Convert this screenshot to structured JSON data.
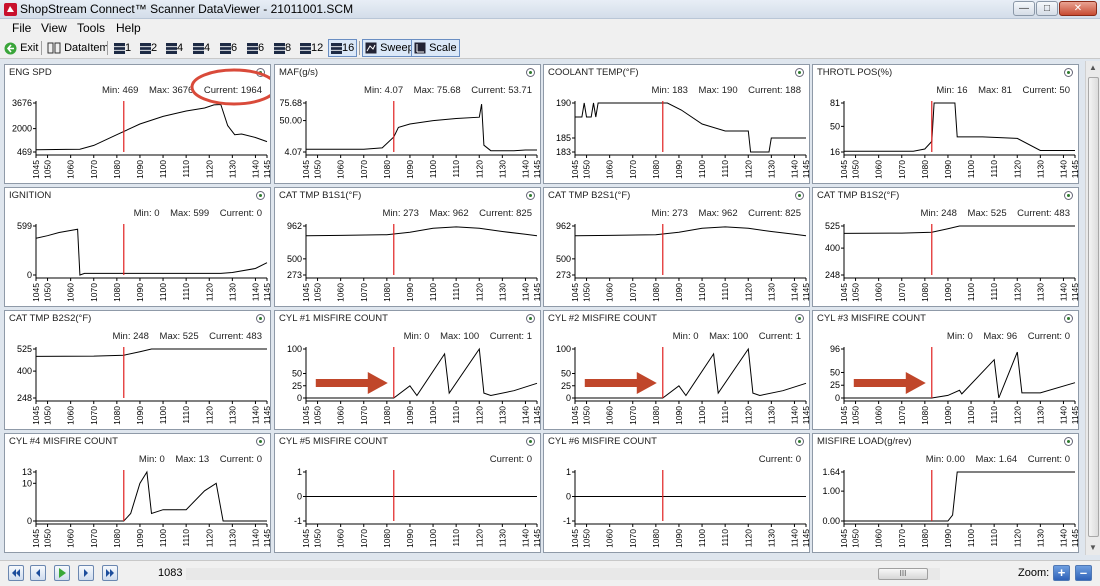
{
  "window": {
    "title": "ShopStream Connect™ Scanner DataViewer - 21011001.SCM"
  },
  "menu": [
    "File",
    "View",
    "Tools",
    "Help"
  ],
  "toolbar": {
    "exit": "Exit",
    "dataitem": "DataItem",
    "layouts": [
      "1",
      "2",
      "4",
      "4",
      "6",
      "6",
      "8",
      "12",
      "16"
    ],
    "sweep": "Sweep",
    "scale": "Scale"
  },
  "x_ticks": [
    "1045",
    "1050",
    "1060",
    "1070",
    "1080",
    "1090",
    "1100",
    "1110",
    "1120",
    "1130",
    "1140",
    "1145"
  ],
  "x_range": [
    1045,
    1145
  ],
  "cursor_x": 1083,
  "colors": {
    "cursor": "#e02020",
    "trace": "#000000",
    "arrow": "#c0462a",
    "annotation_circle": "#d94a3a"
  },
  "panels": [
    {
      "title": "ENG SPD",
      "min": "469",
      "max": "3676",
      "current": "1964",
      "ymin": 469,
      "ymax": 3676,
      "yticks": [
        {
          "v": 3676,
          "t": "3676"
        },
        {
          "v": 2000,
          "t": "2000"
        },
        {
          "v": 469,
          "t": "469"
        }
      ],
      "points": [
        [
          1045,
          620
        ],
        [
          1058,
          640
        ],
        [
          1064,
          650
        ],
        [
          1070,
          900
        ],
        [
          1080,
          1600
        ],
        [
          1090,
          2300
        ],
        [
          1100,
          2800
        ],
        [
          1110,
          3150
        ],
        [
          1118,
          3350
        ],
        [
          1122,
          3550
        ],
        [
          1125,
          3580
        ],
        [
          1128,
          2200
        ],
        [
          1131,
          1600
        ],
        [
          1134,
          1650
        ],
        [
          1140,
          1420
        ],
        [
          1145,
          1150
        ]
      ],
      "annotation": "circle-current"
    },
    {
      "title": "MAF(g/s)",
      "min": "4.07",
      "max": "75.68",
      "current": "53.71",
      "ymin": 4.07,
      "ymax": 75.68,
      "yticks": [
        {
          "v": 75.68,
          "t": "75.68"
        },
        {
          "v": 50,
          "t": "50.00"
        },
        {
          "v": 4.07,
          "t": "4.07"
        }
      ],
      "points": [
        [
          1045,
          8
        ],
        [
          1070,
          8
        ],
        [
          1078,
          10
        ],
        [
          1083,
          26
        ],
        [
          1085,
          40
        ],
        [
          1090,
          45
        ],
        [
          1100,
          50
        ],
        [
          1110,
          53
        ],
        [
          1120,
          55
        ],
        [
          1121,
          74
        ],
        [
          1122,
          14
        ],
        [
          1125,
          6
        ],
        [
          1135,
          6
        ],
        [
          1140,
          7
        ],
        [
          1145,
          7
        ]
      ]
    },
    {
      "title": "COOLANT TEMP(°F)",
      "min": "183",
      "max": "190",
      "current": "188",
      "ymin": 183,
      "ymax": 190,
      "yticks": [
        {
          "v": 190,
          "t": "190"
        },
        {
          "v": 185,
          "t": "185"
        },
        {
          "v": 183,
          "t": "183"
        }
      ],
      "points": [
        [
          1045,
          188
        ],
        [
          1048,
          188
        ],
        [
          1049,
          190
        ],
        [
          1050,
          188
        ],
        [
          1052,
          188
        ],
        [
          1053,
          190
        ],
        [
          1054,
          188
        ],
        [
          1055,
          190
        ],
        [
          1085,
          190
        ],
        [
          1091,
          189
        ],
        [
          1100,
          187
        ],
        [
          1110,
          186
        ],
        [
          1120,
          186
        ],
        [
          1121,
          183
        ],
        [
          1129,
          183
        ],
        [
          1130,
          185
        ],
        [
          1145,
          185
        ]
      ]
    },
    {
      "title": "THROTL POS(%)",
      "min": "16",
      "max": "81",
      "current": "50",
      "ymin": 16,
      "ymax": 81,
      "yticks": [
        {
          "v": 81,
          "t": "81"
        },
        {
          "v": 50,
          "t": "50"
        },
        {
          "v": 16,
          "t": "16"
        }
      ],
      "points": [
        [
          1045,
          17
        ],
        [
          1075,
          17
        ],
        [
          1080,
          20
        ],
        [
          1083,
          30
        ],
        [
          1084,
          81
        ],
        [
          1093,
          81
        ],
        [
          1094,
          36
        ],
        [
          1105,
          36
        ],
        [
          1120,
          34
        ],
        [
          1130,
          18
        ],
        [
          1145,
          18
        ]
      ]
    },
    {
      "title": "IGNITION",
      "min": "0",
      "max": "599",
      "current": "0",
      "ymin": 0,
      "ymax": 599,
      "yticks": [
        {
          "v": 599,
          "t": "599"
        },
        {
          "v": 0,
          "t": "0"
        }
      ],
      "points": [
        [
          1045,
          450
        ],
        [
          1050,
          480
        ],
        [
          1055,
          520
        ],
        [
          1063,
          560
        ],
        [
          1064,
          0
        ],
        [
          1066,
          20
        ],
        [
          1070,
          20
        ],
        [
          1090,
          20
        ],
        [
          1110,
          20
        ],
        [
          1125,
          20
        ],
        [
          1130,
          30
        ],
        [
          1140,
          80
        ],
        [
          1145,
          150
        ]
      ]
    },
    {
      "title": "CAT TMP B1S1(°F)",
      "min": "273",
      "max": "962",
      "current": "825",
      "ymin": 273,
      "ymax": 962,
      "yticks": [
        {
          "v": 962,
          "t": "962"
        },
        {
          "v": 500,
          "t": "500"
        },
        {
          "v": 273,
          "t": "273"
        }
      ],
      "points": [
        [
          1045,
          825
        ],
        [
          1060,
          830
        ],
        [
          1080,
          840
        ],
        [
          1090,
          875
        ],
        [
          1100,
          930
        ],
        [
          1110,
          950
        ],
        [
          1120,
          930
        ],
        [
          1130,
          885
        ],
        [
          1140,
          845
        ],
        [
          1145,
          825
        ]
      ]
    },
    {
      "title": "CAT TMP B2S1(°F)",
      "min": "273",
      "max": "962",
      "current": "825",
      "ymin": 273,
      "ymax": 962,
      "yticks": [
        {
          "v": 962,
          "t": "962"
        },
        {
          "v": 500,
          "t": "500"
        },
        {
          "v": 273,
          "t": "273"
        }
      ],
      "points": [
        [
          1045,
          825
        ],
        [
          1060,
          830
        ],
        [
          1080,
          840
        ],
        [
          1090,
          875
        ],
        [
          1100,
          930
        ],
        [
          1110,
          950
        ],
        [
          1120,
          930
        ],
        [
          1130,
          885
        ],
        [
          1140,
          845
        ],
        [
          1145,
          825
        ]
      ]
    },
    {
      "title": "CAT TMP B1S2(°F)",
      "min": "248",
      "max": "525",
      "current": "483",
      "ymin": 248,
      "ymax": 525,
      "yticks": [
        {
          "v": 525,
          "t": "525"
        },
        {
          "v": 400,
          "t": "400"
        },
        {
          "v": 248,
          "t": "248"
        }
      ],
      "points": [
        [
          1045,
          483
        ],
        [
          1070,
          485
        ],
        [
          1083,
          490
        ],
        [
          1090,
          510
        ],
        [
          1095,
          525
        ],
        [
          1110,
          525
        ],
        [
          1145,
          525
        ]
      ]
    },
    {
      "title": "CAT TMP B2S2(°F)",
      "min": "248",
      "max": "525",
      "current": "483",
      "ymin": 248,
      "ymax": 525,
      "yticks": [
        {
          "v": 525,
          "t": "525"
        },
        {
          "v": 400,
          "t": "400"
        },
        {
          "v": 248,
          "t": "248"
        }
      ],
      "points": [
        [
          1045,
          483
        ],
        [
          1070,
          485
        ],
        [
          1083,
          490
        ],
        [
          1090,
          510
        ],
        [
          1095,
          525
        ],
        [
          1110,
          525
        ],
        [
          1145,
          525
        ]
      ]
    },
    {
      "title": "CYL #1 MISFIRE COUNT",
      "min": "0",
      "max": "100",
      "current": "1",
      "ymin": 0,
      "ymax": 100,
      "yticks": [
        {
          "v": 100,
          "t": "100"
        },
        {
          "v": 50,
          "t": "50"
        },
        {
          "v": 25,
          "t": "25"
        },
        {
          "v": 0,
          "t": "0"
        }
      ],
      "points": [
        [
          1045,
          0
        ],
        [
          1083,
          0
        ],
        [
          1090,
          25
        ],
        [
          1093,
          5
        ],
        [
          1105,
          90
        ],
        [
          1107,
          10
        ],
        [
          1120,
          100
        ],
        [
          1122,
          10
        ],
        [
          1125,
          5
        ],
        [
          1135,
          15
        ],
        [
          1145,
          30
        ]
      ],
      "annotation": "arrow"
    },
    {
      "title": "CYL #2 MISFIRE COUNT",
      "min": "0",
      "max": "100",
      "current": "1",
      "ymin": 0,
      "ymax": 100,
      "yticks": [
        {
          "v": 100,
          "t": "100"
        },
        {
          "v": 50,
          "t": "50"
        },
        {
          "v": 25,
          "t": "25"
        },
        {
          "v": 0,
          "t": "0"
        }
      ],
      "points": [
        [
          1045,
          0
        ],
        [
          1083,
          0
        ],
        [
          1090,
          25
        ],
        [
          1093,
          5
        ],
        [
          1105,
          90
        ],
        [
          1107,
          10
        ],
        [
          1120,
          100
        ],
        [
          1122,
          10
        ],
        [
          1125,
          5
        ],
        [
          1135,
          15
        ],
        [
          1145,
          30
        ]
      ],
      "annotation": "arrow"
    },
    {
      "title": "CYL #3 MISFIRE COUNT",
      "min": "0",
      "max": "96",
      "current": "0",
      "ymin": 0,
      "ymax": 96,
      "yticks": [
        {
          "v": 96,
          "t": "96"
        },
        {
          "v": 50,
          "t": "50"
        },
        {
          "v": 25,
          "t": "25"
        },
        {
          "v": 0,
          "t": "0"
        }
      ],
      "points": [
        [
          1045,
          0
        ],
        [
          1083,
          0
        ],
        [
          1090,
          5
        ],
        [
          1095,
          15
        ],
        [
          1096,
          8
        ],
        [
          1110,
          75
        ],
        [
          1112,
          0
        ],
        [
          1120,
          90
        ],
        [
          1122,
          10
        ],
        [
          1130,
          10
        ],
        [
          1145,
          30
        ]
      ],
      "annotation": "arrow"
    },
    {
      "title": "CYL #4 MISFIRE COUNT",
      "min": "0",
      "max": "13",
      "current": "0",
      "ymin": 0,
      "ymax": 13,
      "yticks": [
        {
          "v": 13,
          "t": "13"
        },
        {
          "v": 10,
          "t": "10"
        },
        {
          "v": 0,
          "t": "0"
        }
      ],
      "points": [
        [
          1045,
          0
        ],
        [
          1083,
          0
        ],
        [
          1086,
          2
        ],
        [
          1090,
          10
        ],
        [
          1093,
          13
        ],
        [
          1095,
          2
        ],
        [
          1100,
          3
        ],
        [
          1110,
          3
        ],
        [
          1118,
          8
        ],
        [
          1123,
          10
        ],
        [
          1126,
          0
        ],
        [
          1145,
          0
        ]
      ]
    },
    {
      "title": "CYL #5 MISFIRE COUNT",
      "min": "",
      "max": "",
      "current": "0",
      "ymin": -1,
      "ymax": 1,
      "yticks": [
        {
          "v": 1,
          "t": "1"
        },
        {
          "v": 0,
          "t": "0"
        },
        {
          "v": -1,
          "t": "-1"
        }
      ],
      "points": [
        [
          1045,
          0
        ],
        [
          1145,
          0
        ]
      ]
    },
    {
      "title": "CYL #6 MISFIRE COUNT",
      "min": "",
      "max": "",
      "current": "0",
      "ymin": -1,
      "ymax": 1,
      "yticks": [
        {
          "v": 1,
          "t": "1"
        },
        {
          "v": 0,
          "t": "0"
        },
        {
          "v": -1,
          "t": "-1"
        }
      ],
      "points": [
        [
          1045,
          0
        ],
        [
          1145,
          0
        ]
      ]
    },
    {
      "title": "MISFIRE LOAD(g/rev)",
      "min": "0.00",
      "max": "1.64",
      "current": "0",
      "ymin": 0,
      "ymax": 1.64,
      "yticks": [
        {
          "v": 1.64,
          "t": "1.64"
        },
        {
          "v": 1.0,
          "t": "1.00"
        },
        {
          "v": 0,
          "t": "0.00"
        }
      ],
      "points": [
        [
          1045,
          0
        ],
        [
          1090,
          0
        ],
        [
          1092,
          0.2
        ],
        [
          1094,
          1.64
        ],
        [
          1145,
          1.64
        ]
      ]
    }
  ],
  "bottom": {
    "frame": "1083",
    "zoom_label": "Zoom:",
    "scroll_grip": "III"
  }
}
